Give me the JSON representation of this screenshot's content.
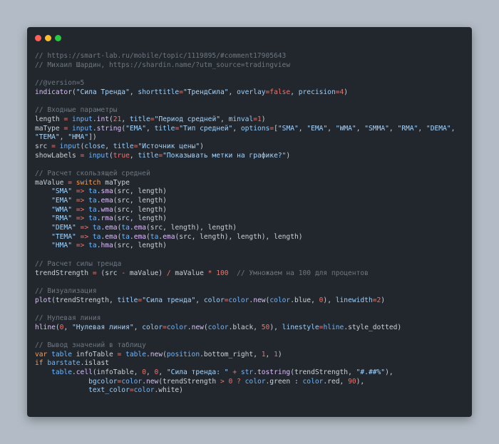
{
  "window": {
    "dots": [
      "#ff5f56",
      "#ffbd2e",
      "#27c93f"
    ]
  },
  "code_lines": [
    [
      [
        "c",
        "// https://smart-lab.ru/mobile/topic/1119895/#comment17905643"
      ]
    ],
    [
      [
        "c",
        "// Михаил Шардин, https://shardin.name/?utm_source=tradingview"
      ]
    ],
    [],
    [
      [
        "c",
        "//@version=5"
      ]
    ],
    [
      [
        "f",
        "indicator"
      ],
      [
        "p",
        "("
      ],
      [
        "s",
        "\"Сила Тренда\""
      ],
      [
        "p",
        ", "
      ],
      [
        "v",
        "shorttitle"
      ],
      [
        "o",
        "="
      ],
      [
        "s",
        "\"ТрендСила\""
      ],
      [
        "p",
        ", "
      ],
      [
        "v",
        "overlay"
      ],
      [
        "o",
        "="
      ],
      [
        "n",
        "false"
      ],
      [
        "p",
        ", "
      ],
      [
        "v",
        "precision"
      ],
      [
        "o",
        "="
      ],
      [
        "n",
        "4"
      ],
      [
        "p",
        ")"
      ]
    ],
    [],
    [
      [
        "c",
        "// Входные параметры"
      ]
    ],
    [
      [
        "p",
        "length "
      ],
      [
        "o",
        "="
      ],
      [
        "p",
        " "
      ],
      [
        "t",
        "input"
      ],
      [
        "p",
        "."
      ],
      [
        "f",
        "int"
      ],
      [
        "p",
        "("
      ],
      [
        "n",
        "21"
      ],
      [
        "p",
        ", "
      ],
      [
        "v",
        "title"
      ],
      [
        "o",
        "="
      ],
      [
        "s",
        "\"Период средней\""
      ],
      [
        "p",
        ", "
      ],
      [
        "v",
        "minval"
      ],
      [
        "o",
        "="
      ],
      [
        "n",
        "1"
      ],
      [
        "p",
        ")"
      ]
    ],
    [
      [
        "p",
        "maType "
      ],
      [
        "o",
        "="
      ],
      [
        "p",
        " "
      ],
      [
        "t",
        "input"
      ],
      [
        "p",
        "."
      ],
      [
        "f",
        "string"
      ],
      [
        "p",
        "("
      ],
      [
        "s",
        "\"EMA\""
      ],
      [
        "p",
        ", "
      ],
      [
        "v",
        "title"
      ],
      [
        "o",
        "="
      ],
      [
        "s",
        "\"Тип средней\""
      ],
      [
        "p",
        ", "
      ],
      [
        "v",
        "options"
      ],
      [
        "o",
        "="
      ],
      [
        "p",
        "["
      ],
      [
        "s",
        "\"SMA\""
      ],
      [
        "p",
        ", "
      ],
      [
        "s",
        "\"EMA\""
      ],
      [
        "p",
        ", "
      ],
      [
        "s",
        "\"WMA\""
      ],
      [
        "p",
        ", "
      ],
      [
        "s",
        "\"SMMA\""
      ],
      [
        "p",
        ", "
      ],
      [
        "s",
        "\"RMA\""
      ],
      [
        "p",
        ", "
      ],
      [
        "s",
        "\"DEMA\""
      ],
      [
        "p",
        ","
      ]
    ],
    [
      [
        "s",
        "\"TEMA\""
      ],
      [
        "p",
        ", "
      ],
      [
        "s",
        "\"HMA\""
      ],
      [
        "p",
        "])"
      ]
    ],
    [
      [
        "p",
        "src "
      ],
      [
        "o",
        "="
      ],
      [
        "p",
        " "
      ],
      [
        "t",
        "input"
      ],
      [
        "p",
        "("
      ],
      [
        "v",
        "close"
      ],
      [
        "p",
        ", "
      ],
      [
        "v",
        "title"
      ],
      [
        "o",
        "="
      ],
      [
        "s",
        "\"Источник цены\""
      ],
      [
        "p",
        ")"
      ]
    ],
    [
      [
        "p",
        "showLabels "
      ],
      [
        "o",
        "="
      ],
      [
        "p",
        " "
      ],
      [
        "t",
        "input"
      ],
      [
        "p",
        "("
      ],
      [
        "n",
        "true"
      ],
      [
        "p",
        ", "
      ],
      [
        "v",
        "title"
      ],
      [
        "o",
        "="
      ],
      [
        "s",
        "\"Показывать метки на графике?\""
      ],
      [
        "p",
        ")"
      ]
    ],
    [],
    [
      [
        "c",
        "// Расчет скользящей средней"
      ]
    ],
    [
      [
        "p",
        "maValue "
      ],
      [
        "o",
        "="
      ],
      [
        "p",
        " "
      ],
      [
        "y",
        "switch"
      ],
      [
        "p",
        " maType"
      ]
    ],
    [
      [
        "p",
        "    "
      ],
      [
        "s",
        "\"SMA\""
      ],
      [
        "p",
        " "
      ],
      [
        "o",
        "=>"
      ],
      [
        "p",
        " "
      ],
      [
        "t",
        "ta"
      ],
      [
        "p",
        "."
      ],
      [
        "f",
        "sma"
      ],
      [
        "p",
        "(src, length)"
      ]
    ],
    [
      [
        "p",
        "    "
      ],
      [
        "s",
        "\"EMA\""
      ],
      [
        "p",
        " "
      ],
      [
        "o",
        "=>"
      ],
      [
        "p",
        " "
      ],
      [
        "t",
        "ta"
      ],
      [
        "p",
        "."
      ],
      [
        "f",
        "ema"
      ],
      [
        "p",
        "(src, length)"
      ]
    ],
    [
      [
        "p",
        "    "
      ],
      [
        "s",
        "\"WMA\""
      ],
      [
        "p",
        " "
      ],
      [
        "o",
        "=>"
      ],
      [
        "p",
        " "
      ],
      [
        "t",
        "ta"
      ],
      [
        "p",
        "."
      ],
      [
        "f",
        "wma"
      ],
      [
        "p",
        "(src, length)"
      ]
    ],
    [
      [
        "p",
        "    "
      ],
      [
        "s",
        "\"RMA\""
      ],
      [
        "p",
        " "
      ],
      [
        "o",
        "=>"
      ],
      [
        "p",
        " "
      ],
      [
        "t",
        "ta"
      ],
      [
        "p",
        "."
      ],
      [
        "f",
        "rma"
      ],
      [
        "p",
        "(src, length)"
      ]
    ],
    [
      [
        "p",
        "    "
      ],
      [
        "s",
        "\"DEMA\""
      ],
      [
        "p",
        " "
      ],
      [
        "o",
        "=>"
      ],
      [
        "p",
        " "
      ],
      [
        "t",
        "ta"
      ],
      [
        "p",
        "."
      ],
      [
        "f",
        "ema"
      ],
      [
        "p",
        "("
      ],
      [
        "t",
        "ta"
      ],
      [
        "p",
        "."
      ],
      [
        "f",
        "ema"
      ],
      [
        "p",
        "(src, length), length)"
      ]
    ],
    [
      [
        "p",
        "    "
      ],
      [
        "s",
        "\"TEMA\""
      ],
      [
        "p",
        " "
      ],
      [
        "o",
        "=>"
      ],
      [
        "p",
        " "
      ],
      [
        "t",
        "ta"
      ],
      [
        "p",
        "."
      ],
      [
        "f",
        "ema"
      ],
      [
        "p",
        "("
      ],
      [
        "t",
        "ta"
      ],
      [
        "p",
        "."
      ],
      [
        "f",
        "ema"
      ],
      [
        "p",
        "("
      ],
      [
        "t",
        "ta"
      ],
      [
        "p",
        "."
      ],
      [
        "f",
        "ema"
      ],
      [
        "p",
        "(src, length), length), length)"
      ]
    ],
    [
      [
        "p",
        "    "
      ],
      [
        "s",
        "\"HMA\""
      ],
      [
        "p",
        " "
      ],
      [
        "o",
        "=>"
      ],
      [
        "p",
        " "
      ],
      [
        "t",
        "ta"
      ],
      [
        "p",
        "."
      ],
      [
        "f",
        "hma"
      ],
      [
        "p",
        "(src, length)"
      ]
    ],
    [],
    [
      [
        "c",
        "// Расчет силы тренда"
      ]
    ],
    [
      [
        "p",
        "trendStrength "
      ],
      [
        "o",
        "="
      ],
      [
        "p",
        " (src "
      ],
      [
        "o",
        "-"
      ],
      [
        "p",
        " maValue) "
      ],
      [
        "o",
        "/"
      ],
      [
        "p",
        " maValue "
      ],
      [
        "o",
        "*"
      ],
      [
        "p",
        " "
      ],
      [
        "n",
        "100"
      ],
      [
        "p",
        "  "
      ],
      [
        "c",
        "// Умножаем на 100 для процентов"
      ]
    ],
    [],
    [
      [
        "c",
        "// Визуализация"
      ]
    ],
    [
      [
        "f",
        "plot"
      ],
      [
        "p",
        "(trendStrength, "
      ],
      [
        "v",
        "title"
      ],
      [
        "o",
        "="
      ],
      [
        "s",
        "\"Сила тренда\""
      ],
      [
        "p",
        ", "
      ],
      [
        "v",
        "color"
      ],
      [
        "o",
        "="
      ],
      [
        "t",
        "color"
      ],
      [
        "p",
        "."
      ],
      [
        "f",
        "new"
      ],
      [
        "p",
        "("
      ],
      [
        "t",
        "color"
      ],
      [
        "p",
        ".blue, "
      ],
      [
        "n",
        "0"
      ],
      [
        "p",
        "), "
      ],
      [
        "v",
        "linewidth"
      ],
      [
        "o",
        "="
      ],
      [
        "n",
        "2"
      ],
      [
        "p",
        ")"
      ]
    ],
    [],
    [
      [
        "c",
        "// Нулевая линия"
      ]
    ],
    [
      [
        "f",
        "hline"
      ],
      [
        "p",
        "("
      ],
      [
        "n",
        "0"
      ],
      [
        "p",
        ", "
      ],
      [
        "s",
        "\"Нулевая линия\""
      ],
      [
        "p",
        ", "
      ],
      [
        "v",
        "color"
      ],
      [
        "o",
        "="
      ],
      [
        "t",
        "color"
      ],
      [
        "p",
        "."
      ],
      [
        "f",
        "new"
      ],
      [
        "p",
        "("
      ],
      [
        "t",
        "color"
      ],
      [
        "p",
        ".black, "
      ],
      [
        "n",
        "50"
      ],
      [
        "p",
        "), "
      ],
      [
        "v",
        "linestyle"
      ],
      [
        "o",
        "="
      ],
      [
        "t",
        "hline"
      ],
      [
        "p",
        ".style_dotted)"
      ]
    ],
    [],
    [
      [
        "c",
        "// Вывод значений в таблицу"
      ]
    ],
    [
      [
        "y",
        "var"
      ],
      [
        "p",
        " "
      ],
      [
        "t",
        "table"
      ],
      [
        "p",
        " infoTable "
      ],
      [
        "o",
        "="
      ],
      [
        "p",
        " "
      ],
      [
        "t",
        "table"
      ],
      [
        "p",
        "."
      ],
      [
        "f",
        "new"
      ],
      [
        "p",
        "("
      ],
      [
        "t",
        "position"
      ],
      [
        "p",
        ".bottom_right, "
      ],
      [
        "n",
        "1"
      ],
      [
        "p",
        ", "
      ],
      [
        "n",
        "1"
      ],
      [
        "p",
        ")"
      ]
    ],
    [
      [
        "y",
        "if"
      ],
      [
        "p",
        " "
      ],
      [
        "t",
        "barstate"
      ],
      [
        "p",
        ".islast"
      ]
    ],
    [
      [
        "p",
        "    "
      ],
      [
        "t",
        "table"
      ],
      [
        "p",
        "."
      ],
      [
        "f",
        "cell"
      ],
      [
        "p",
        "(infoTable, "
      ],
      [
        "n",
        "0"
      ],
      [
        "p",
        ", "
      ],
      [
        "n",
        "0"
      ],
      [
        "p",
        ", "
      ],
      [
        "s",
        "\"Сила тренда: \""
      ],
      [
        "p",
        " "
      ],
      [
        "o",
        "+"
      ],
      [
        "p",
        " "
      ],
      [
        "t",
        "str"
      ],
      [
        "p",
        "."
      ],
      [
        "f",
        "tostring"
      ],
      [
        "p",
        "(trendStrength, "
      ],
      [
        "s",
        "\"#.##%\""
      ],
      [
        "p",
        "),"
      ]
    ],
    [
      [
        "p",
        "             "
      ],
      [
        "v",
        "bgcolor"
      ],
      [
        "o",
        "="
      ],
      [
        "t",
        "color"
      ],
      [
        "p",
        "."
      ],
      [
        "f",
        "new"
      ],
      [
        "p",
        "(trendStrength "
      ],
      [
        "o",
        ">"
      ],
      [
        "p",
        " "
      ],
      [
        "n",
        "0"
      ],
      [
        "p",
        " "
      ],
      [
        "o",
        "?"
      ],
      [
        "p",
        " "
      ],
      [
        "t",
        "color"
      ],
      [
        "p",
        ".green : "
      ],
      [
        "t",
        "color"
      ],
      [
        "p",
        ".red, "
      ],
      [
        "n",
        "90"
      ],
      [
        "p",
        "),"
      ]
    ],
    [
      [
        "p",
        "             "
      ],
      [
        "v",
        "text_color"
      ],
      [
        "o",
        "="
      ],
      [
        "t",
        "color"
      ],
      [
        "p",
        ".white)"
      ]
    ]
  ]
}
